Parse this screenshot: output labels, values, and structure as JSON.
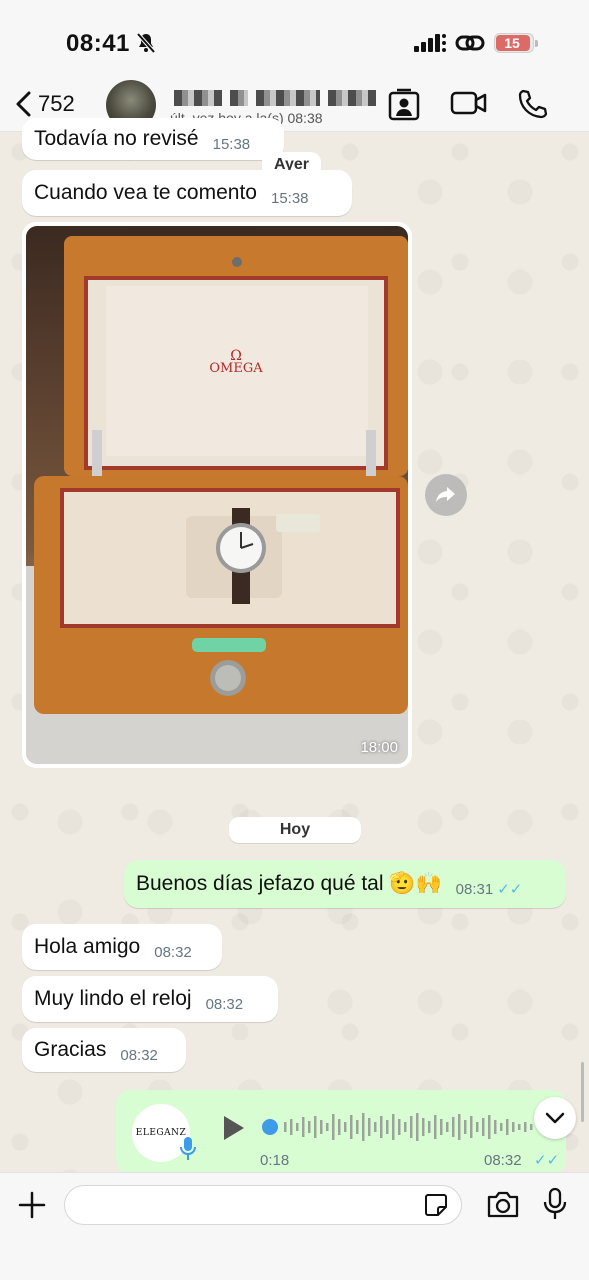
{
  "status": {
    "time": "08:41",
    "battery": "15"
  },
  "header": {
    "back_count": "752",
    "last_seen": "últ. vez hoy a la(s) 08:38"
  },
  "messages": {
    "m1": {
      "text": "Todavía no revisé",
      "time": "15:38"
    },
    "date_ayer": "Ayer",
    "m2": {
      "text": "Cuando vea te comento",
      "time": "15:38"
    },
    "image": {
      "time": "18:00",
      "brand": "OMEGA"
    },
    "date_hoy": "Hoy",
    "m3": {
      "text": "Buenos días jefazo qué tal 🫡🙌",
      "time": "08:31",
      "ticks": "✓✓"
    },
    "m4": {
      "text": "Hola amigo",
      "time": "08:32"
    },
    "m5": {
      "text": "Muy lindo el reloj",
      "time": "08:32"
    },
    "m6": {
      "text": "Gracias",
      "time": "08:32"
    },
    "voice": {
      "avatar_text": "ELEGANZ",
      "duration": "0:18",
      "time": "08:32",
      "ticks": "✓✓"
    }
  },
  "input": {
    "placeholder": ""
  }
}
